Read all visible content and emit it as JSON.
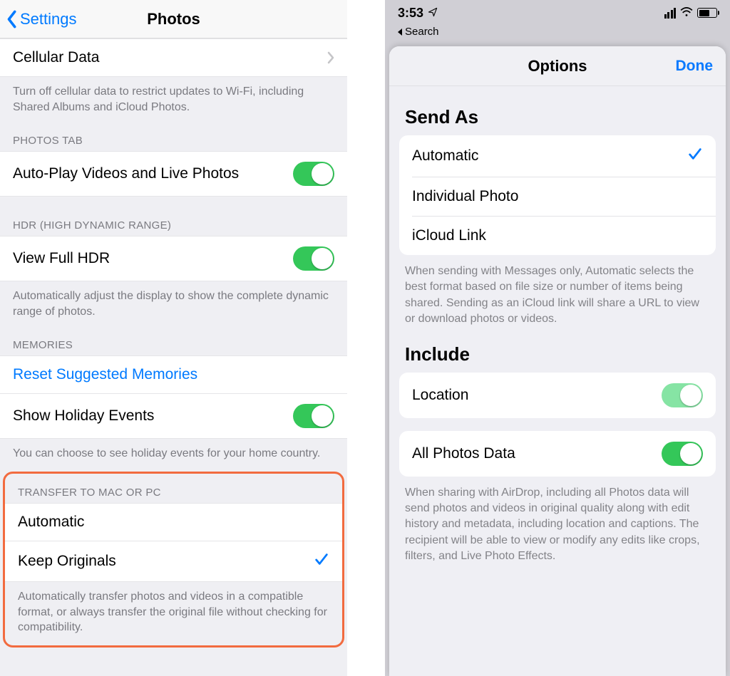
{
  "left": {
    "nav": {
      "back": "Settings",
      "title": "Photos"
    },
    "cellular": {
      "label": "Cellular Data",
      "footer": "Turn off cellular data to restrict updates to Wi-Fi, including Shared Albums and iCloud Photos."
    },
    "photos_tab": {
      "header": "PHOTOS TAB",
      "autoplay_label": "Auto-Play Videos and Live Photos"
    },
    "hdr": {
      "header": "HDR (HIGH DYNAMIC RANGE)",
      "view_full_label": "View Full HDR",
      "footer": "Automatically adjust the display to show the complete dynamic range of photos."
    },
    "memories": {
      "header": "MEMORIES",
      "reset_label": "Reset Suggested Memories",
      "show_holiday_label": "Show Holiday Events",
      "footer": "You can choose to see holiday events for your home country."
    },
    "transfer": {
      "header": "TRANSFER TO MAC OR PC",
      "automatic_label": "Automatic",
      "keep_originals_label": "Keep Originals",
      "footer": "Automatically transfer photos and videos in a compatible format, or always transfer the original file without checking for compatibility."
    }
  },
  "right": {
    "status": {
      "time": "3:53",
      "back_search": "Search"
    },
    "sheet": {
      "title": "Options",
      "done": "Done",
      "send_as": {
        "title": "Send As",
        "automatic": "Automatic",
        "individual": "Individual Photo",
        "icloud_link": "iCloud Link",
        "footer": "When sending with Messages only, Automatic selects the best format based on file size or number of items being shared. Sending as an iCloud link will share a URL to view or download photos or videos."
      },
      "include": {
        "title": "Include",
        "location": "Location",
        "all_photos_data": "All Photos Data",
        "footer": "When sharing with AirDrop, including all Photos data will send photos and videos in original quality along with edit history and metadata, including location and captions. The recipient will be able to view or modify any edits like crops, filters, and Live Photo Effects."
      }
    }
  }
}
